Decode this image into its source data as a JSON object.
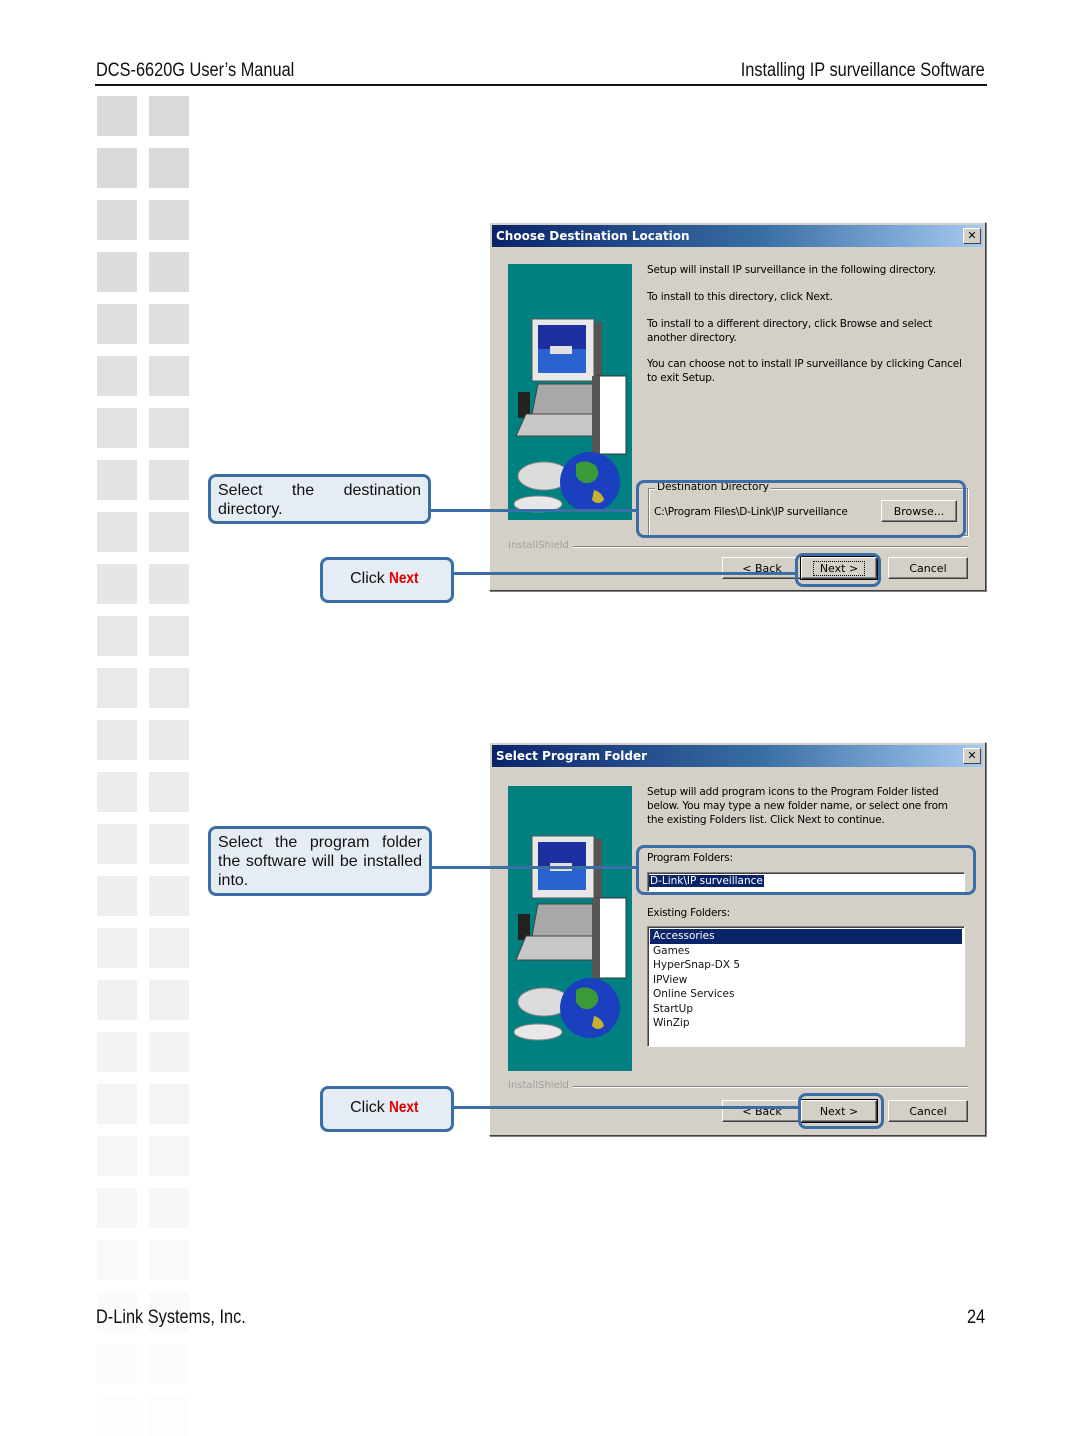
{
  "header": {
    "left": "DCS-6620G User’s Manual",
    "right": "Installing IP surveillance Software"
  },
  "footer": {
    "company": "D-Link Systems, Inc.",
    "page_number": "24"
  },
  "colors": {
    "callout_border": "#3a6ea5",
    "callout_fill": "#e6ecf4",
    "emphasis_red": "#e00000",
    "dialog_face": "#d4d0c8",
    "titlebar_start": "#0a246a",
    "art_teal": "#008080"
  },
  "dialog1": {
    "title": "Choose Destination Location",
    "close_glyph": "✕",
    "paragraphs": [
      "Setup will install IP surveillance in the following directory.",
      "To install to this directory, click Next.",
      "To install to a different directory, click Browse and select another directory.",
      "You can choose not to install IP surveillance by clicking Cancel to exit Setup."
    ],
    "group_label": "Destination Directory",
    "path": "C:\\Program Files\\D-Link\\IP surveillance",
    "browse_label": "Browse...",
    "installshield_label": "InstallShield",
    "back_label": "< Back",
    "next_label": "Next >",
    "cancel_label": "Cancel"
  },
  "dialog2": {
    "title": "Select Program Folder",
    "close_glyph": "✕",
    "intro": "Setup will add program icons to the Program Folder listed below. You may type a new folder name, or select one from the existing Folders list.  Click Next to continue.",
    "program_folders_label": "Program Folders:",
    "program_folder_value": "D-Link\\IP surveillance",
    "existing_folders_label": "Existing Folders:",
    "existing_folders": [
      "Accessories",
      "Games",
      "HyperSnap-DX 5",
      "IPView",
      "Online Services",
      "StartUp",
      "WinZip"
    ],
    "selected_folder": "Accessories",
    "installshield_label": "InstallShield",
    "back_label": "< Back",
    "next_label": "Next >",
    "cancel_label": "Cancel"
  },
  "callouts": {
    "select_destination": "Select the destination directory.",
    "click_prefix": "Click",
    "click_next_word": "Next",
    "select_program_folder": "Select the program folder the software will be installed into."
  },
  "icons": {
    "setup_art": "computer-with-cd-and-globe-illustration"
  }
}
